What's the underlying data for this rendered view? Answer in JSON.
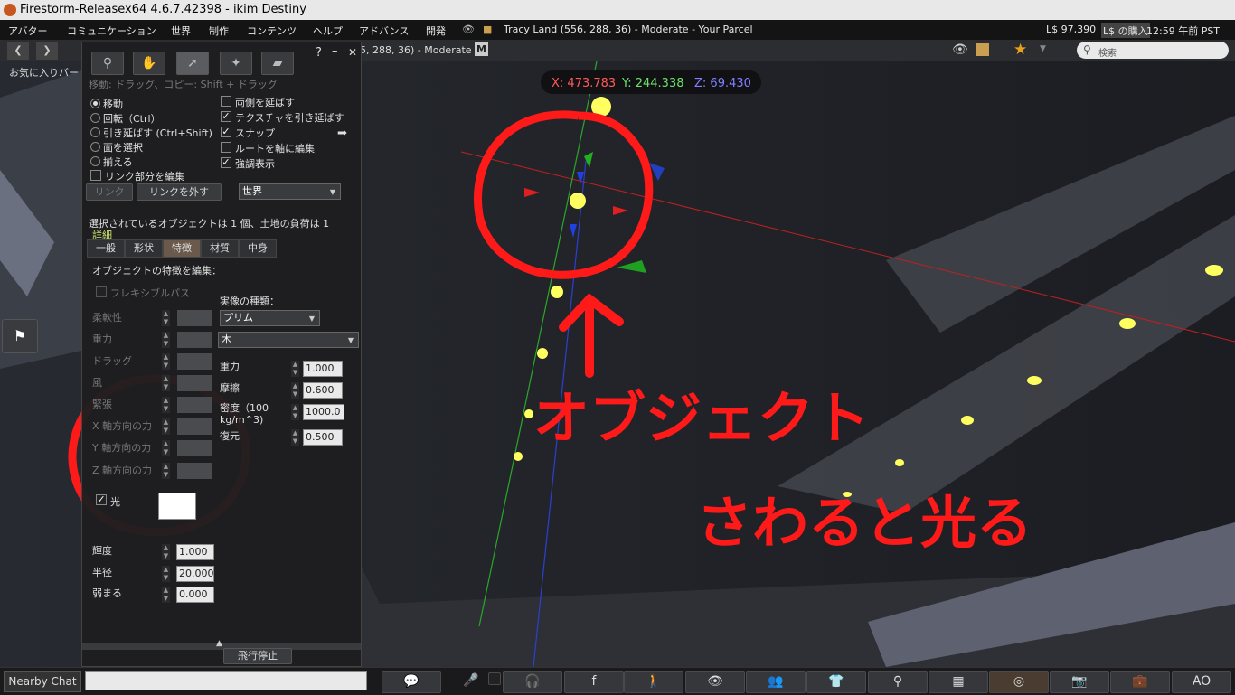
{
  "window_title": "Firestorm-Releasex64 4.6.7.42398 - ikim Destiny",
  "menu": [
    "アバター",
    "コミュニケーション",
    "世界",
    "制作",
    "コンテンツ",
    "ヘルプ",
    "アドバンス",
    "開発"
  ],
  "status": {
    "location": "Tracy Land (556, 288, 36) - Moderate - Your Parcel",
    "balance": "L$ 97,390",
    "buy": "L$ の購入",
    "time": "12:59 午前 PST"
  },
  "nav": {
    "address_fragment": "5, 288, 36) - Moderate",
    "maturity_badge": "M",
    "search_placeholder": "検索",
    "favorites": "お気に入りバー"
  },
  "coords": {
    "x": "X: 473.783",
    "y": "Y: 244.338",
    "z": "Z: 69.430"
  },
  "colors": {
    "x": "#ff5a5a",
    "y": "#6be06b",
    "z": "#8080ff",
    "annotation": "#ff1a1a",
    "accent_tab": "#6b5a4c"
  },
  "floater": {
    "help": "?",
    "minimize": "–",
    "close": "✕",
    "hint": "移動: ドラッグ、コピー: Shift + ドラッグ",
    "modes": [
      "移動",
      "回転（Ctrl）",
      "引き延ばす (Ctrl+Shift)",
      "面を選択",
      "揃える"
    ],
    "edit_linked": "リンク部分を編集",
    "options": [
      {
        "label": "両側を延ばす",
        "checked": false
      },
      {
        "label": "テクスチャを引き延ばす",
        "checked": true
      },
      {
        "label": "スナップ",
        "checked": true
      },
      {
        "label": "ルートを軸に編集",
        "checked": false
      },
      {
        "label": "強調表示",
        "checked": true
      }
    ],
    "link": "リンク",
    "unlink": "リンクを外す",
    "ruler": "世界",
    "selection_info": "選択されているオブジェクトは 1 個、土地の負荷は 1",
    "details": "詳細",
    "tabs": [
      "一般",
      "形状",
      "特徴",
      "材質",
      "中身"
    ],
    "section_title": "オブジェクトの特徴を編集：",
    "flexible": "フレキシブルパス",
    "flex_params": [
      "柔軟性",
      "重力",
      "ドラッグ",
      "風",
      "緊張",
      "X 軸方向の力",
      "Y 軸方向の力",
      "Z 軸方向の力"
    ],
    "physics_shape_label": "実像の種類：",
    "physics_shape": "プリム",
    "material": "木",
    "physics": [
      {
        "label": "重力",
        "value": "1.000"
      },
      {
        "label": "摩擦",
        "value": "0.600"
      },
      {
        "label": "密度（100 kg/m^3)",
        "value": "1000.0"
      },
      {
        "label": "復元",
        "value": "0.500"
      }
    ],
    "light_label": "光",
    "light_checked": "✓",
    "light_params": [
      {
        "label": "輝度",
        "value": "1.000"
      },
      {
        "label": "半径",
        "value": "20.000"
      },
      {
        "label": "弱まる",
        "value": "0.000"
      }
    ],
    "stop_flying": "飛行停止"
  },
  "annotation": {
    "line1": "オブジェクト",
    "line2": "さわると光る"
  },
  "bottom": {
    "nearby_chat": "Nearby Chat",
    "ao": "AO"
  }
}
